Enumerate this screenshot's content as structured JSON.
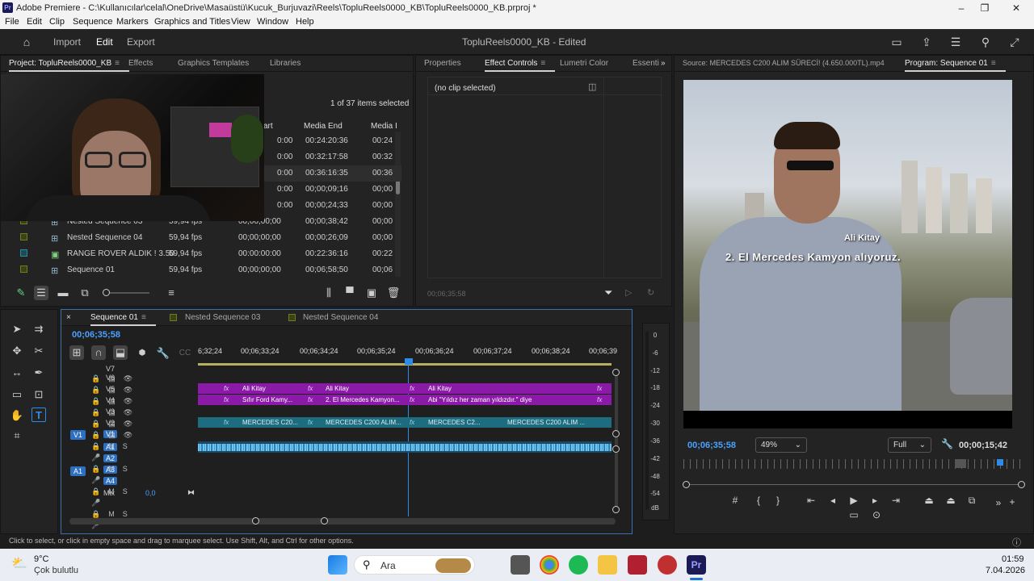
{
  "window": {
    "app_logo": "Pr",
    "title": "Adobe Premiere - C:\\Kullanıcılar\\celal\\OneDrive\\Masaüstü\\Kucuk_Burjuvazi\\Reels\\TopluReels0000_KB\\TopluReels0000_KB.prproj *",
    "minimize": "–",
    "maximize": "❐",
    "close": "✕"
  },
  "menu": [
    "File",
    "Edit",
    "Clip",
    "Sequence",
    "Markers",
    "Graphics and Titles",
    "View",
    "Window",
    "Help"
  ],
  "header": {
    "home_icon": "home-icon",
    "import": "Import",
    "edit": "Edit",
    "export": "Export",
    "doc_title": "TopluReels0000_KB - Edited"
  },
  "project_panel": {
    "tabs": [
      "Project: TopluReels0000_KB",
      "Effects",
      "Graphics Templates",
      "Libraries"
    ],
    "selection_info": "1 of 37 items selected",
    "columns": [
      "art",
      "Media End",
      "Media I"
    ],
    "rows": [
      {
        "name": "",
        "rate": "",
        "start": "0:00",
        "end": "00:24:20:36",
        "dur": "00:24"
      },
      {
        "name": "",
        "rate": "",
        "start": "0:00",
        "end": "00:32:17:58",
        "dur": "00:32"
      },
      {
        "name": "",
        "rate": "",
        "start": "0:00",
        "end": "00:36:16:35",
        "dur": "00:36"
      },
      {
        "name": "",
        "rate": "",
        "start": "0:00",
        "end": "00;00;09;16",
        "dur": "00;00"
      },
      {
        "name": "",
        "rate": "",
        "start": "0:00",
        "end": "00;00;24;33",
        "dur": "00;00"
      },
      {
        "name": "Nested Sequence 03",
        "rate": "59,94 fps",
        "start": "00;00;00;00",
        "end": "00;00;38;42",
        "dur": "00;00"
      },
      {
        "name": "Nested Sequence 04",
        "rate": "59,94 fps",
        "start": "00;00;00;00",
        "end": "00;00;26;09",
        "dur": "00;00"
      },
      {
        "name": "RANGE ROVER ALDIK ! 3.50",
        "rate": "59,94 fps",
        "start": "00:00:00:00",
        "end": "00:22:36:16",
        "dur": "00:22"
      },
      {
        "name": "Sequence 01",
        "rate": "59,94 fps",
        "start": "00;00;00;00",
        "end": "00;06;58;50",
        "dur": "00;06"
      }
    ]
  },
  "effect_controls": {
    "tabs": [
      "Properties",
      "Effect Controls",
      "Lumetri Color",
      "Essenti"
    ],
    "no_clip": "(no clip selected)",
    "timecode": "00;06;35;58"
  },
  "source_monitor": {
    "title": "Source: MERCEDES C200 ALIM SÜRECİ! (4.650.000TL).mp4"
  },
  "program_monitor": {
    "title": "Program: Sequence 01",
    "caption_name": "Ali Kitay",
    "caption_line": "2. El Mercedes Kamyon alıyoruz.",
    "timecode": "00;06;35;58",
    "zoom": "49%",
    "quality": "Full",
    "duration": "00;00;15;42"
  },
  "timeline": {
    "tabs": [
      "Sequence 01",
      "Nested Sequence 03",
      "Nested Sequence 04"
    ],
    "timecode": "00;06;35;58",
    "ruler": [
      "6;32;24",
      "00;06;33;24",
      "00;06;34;24",
      "00;06;35;24",
      "00;06;36;24",
      "00;06;37;24",
      "00;06;38;24",
      "00;06;39"
    ],
    "video_tracks": [
      "V7",
      "V6",
      "V5",
      "V4",
      "V3",
      "V2",
      "V1"
    ],
    "audio_tracks": [
      "A1",
      "A2",
      "A3",
      "A4"
    ],
    "mix_label": "Mix",
    "mix_value": "0,0",
    "source_v": "V1",
    "source_a": "A1",
    "v5_clips": [
      "Ali Kitay",
      "Ali Kitay",
      "Ali Kitay"
    ],
    "v4_clips": [
      "Sıfır Ford Kamy...",
      "2. El Mercedes Kamyon...",
      "Abi \"Yıldız her zaman yıldızdır.\" diye"
    ],
    "v1_clips": [
      "MERCEDES C20...",
      "MERCEDES C200 ALIM...",
      "MERCEDES C2...",
      "MERCEDES C200 ALIM ..."
    ],
    "fx": "fx"
  },
  "meter": [
    "0",
    "-6",
    "-12",
    "-18",
    "-24",
    "-30",
    "-36",
    "-42",
    "-48",
    "-54",
    "dB"
  ],
  "status_bar": "Click to select, or click in empty space and drag to marquee select. Use Shift, Alt, and Ctrl for other options.",
  "taskbar": {
    "temp": "9°C",
    "weather": "Çok bulutlu",
    "search": "Ara",
    "time": "01:59",
    "date": "7.04.2026"
  },
  "colors": {
    "accent": "#2d8ceb",
    "clip_purple": "#8c1aa8",
    "clip_teal": "#1d6c80",
    "audio": "#4aa8e0"
  }
}
